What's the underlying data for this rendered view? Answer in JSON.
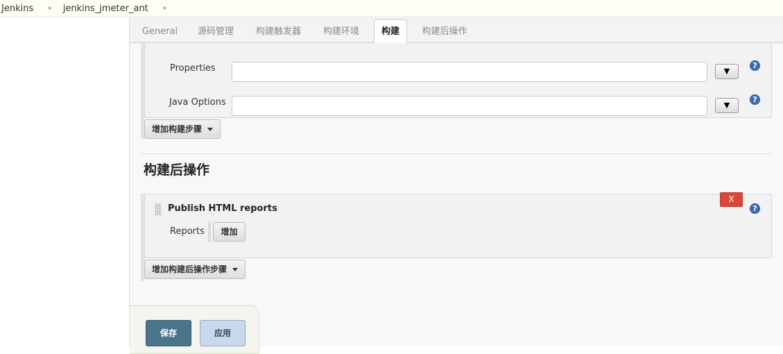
{
  "breadcrumb": {
    "items": [
      "Jenkins",
      "jenkins_jmeter_ant"
    ],
    "separator": "▸"
  },
  "tabs": [
    {
      "label": "General"
    },
    {
      "label": "源码管理"
    },
    {
      "label": "构建触发器"
    },
    {
      "label": "构建环境"
    },
    {
      "label": "构建",
      "active": true
    },
    {
      "label": "构建后操作"
    }
  ],
  "build_step": {
    "properties_label": "Properties",
    "properties_value": "",
    "java_options_label": "Java Options",
    "java_options_value": "",
    "dropdown_glyph": "▼",
    "help_glyph": "?"
  },
  "add_build_step_label": "增加构建步骤",
  "post_build": {
    "section_title": "构建后操作",
    "publisher_title": "Publish HTML reports",
    "delete_label": "X",
    "reports_label": "Reports",
    "add_label": "增加",
    "help_glyph": "?"
  },
  "add_post_build_step_label": "增加构建后操作步骤",
  "footer": {
    "save_label": "保存",
    "apply_label": "应用"
  },
  "colors": {
    "save_button": "#4b758b",
    "apply_button": "#c9d9eb",
    "delete_button": "#d9463a",
    "help_icon": "#3d6fb0"
  }
}
